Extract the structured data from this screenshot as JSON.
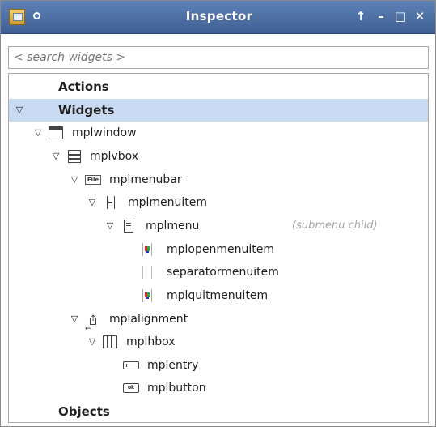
{
  "window": {
    "title": "Inspector",
    "controls": [
      "↑",
      "–",
      "□",
      "✕"
    ]
  },
  "search": {
    "placeholder": "< search widgets >"
  },
  "tree": {
    "sections": {
      "actions": "Actions",
      "widgets": "Widgets",
      "objects": "Objects"
    },
    "items": [
      {
        "label": "mplwindow",
        "icon": "window-icon"
      },
      {
        "label": "mplvbox",
        "icon": "vbox-icon"
      },
      {
        "label": "mplmenubar",
        "icon": "file-menubar-icon",
        "icon_text": "File"
      },
      {
        "label": "mplmenuitem",
        "icon": "menuitem-icon"
      },
      {
        "label": "mplmenu",
        "icon": "menu-icon",
        "hint": "(submenu child)"
      },
      {
        "label": "mplopenmenuitem",
        "icon": "image-menuitem-icon"
      },
      {
        "label": "separatormenuitem",
        "icon": "separator-icon"
      },
      {
        "label": "mplquitmenuitem",
        "icon": "image-menuitem-icon"
      },
      {
        "label": "mplalignment",
        "icon": "alignment-icon"
      },
      {
        "label": "mplhbox",
        "icon": "hbox-icon"
      },
      {
        "label": "mplentry",
        "icon": "entry-icon"
      },
      {
        "label": "mplbutton",
        "icon": "button-icon",
        "icon_text": "ok"
      }
    ]
  },
  "colors": {
    "titlebar": "#4a6da4",
    "selection": "#c8daf2",
    "hint_text": "#a4a4a4"
  }
}
